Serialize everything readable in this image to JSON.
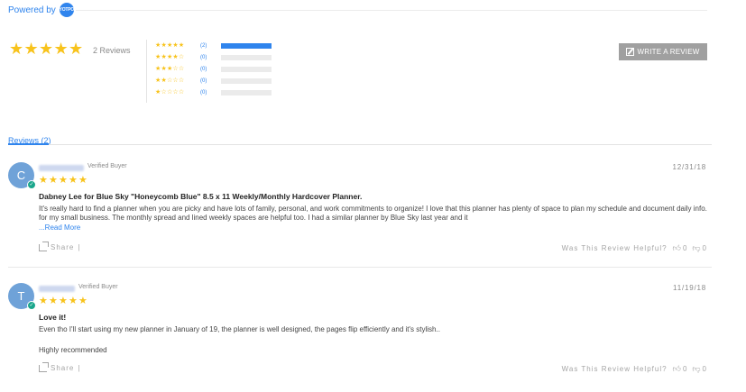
{
  "powered": {
    "label": "Powered by",
    "logo_text": "YOTPO"
  },
  "summary": {
    "average_stars": 5,
    "total_reviews": "2 Reviews",
    "distribution": [
      {
        "stars": "★★★★★",
        "count": "(2)",
        "fraction": 1.0
      },
      {
        "stars": "★★★★☆",
        "count": "(0)",
        "fraction": 0.0
      },
      {
        "stars": "★★★☆☆",
        "count": "(0)",
        "fraction": 0.0
      },
      {
        "stars": "★★☆☆☆",
        "count": "(0)",
        "fraction": 0.0
      },
      {
        "stars": "★☆☆☆☆",
        "count": "(0)",
        "fraction": 0.0
      }
    ]
  },
  "write_review": {
    "label": "WRITE A REVIEW",
    "icon": "pencil-icon"
  },
  "tabs": {
    "reviews_label": "Reviews (2)"
  },
  "reviews": [
    {
      "initial": "C",
      "verified": "Verified Buyer",
      "date": "12/31/18",
      "rating": 5,
      "title": "Dabney Lee for Blue Sky \"Honeycomb Blue\" 8.5 x 11 Weekly/Monthly Hardcover Planner.",
      "body": "It's really hard to find a planner when you are picky and have lots of family, personal, and work commitments to organize! I love that this planner has plenty of space to plan my schedule and document daily info. for my small business. The monthly spread and lined weekly spaces are helpful too. I had a similar planner by Blue Sky last year and it",
      "read_more": "...Read More",
      "share": "Share",
      "helpful": "Was This Review Helpful?",
      "up_votes": "0",
      "down_votes": "0"
    },
    {
      "initial": "T",
      "verified": "Verified Buyer",
      "date": "11/19/18",
      "rating": 5,
      "title": "Love it!",
      "body": "Even tho I'll start using my new planner in January of 19, the planner is well designed, the pages flip efficiently and it's stylish..",
      "body2": "Highly recommended",
      "share": "Share",
      "helpful": "Was This Review Helpful?",
      "up_votes": "0",
      "down_votes": "0"
    }
  ],
  "separator": "|",
  "colors": {
    "accent": "#2f84ed",
    "star": "#f8c31c",
    "verified": "#1aa68c",
    "avatar": "#6fa2d8"
  }
}
